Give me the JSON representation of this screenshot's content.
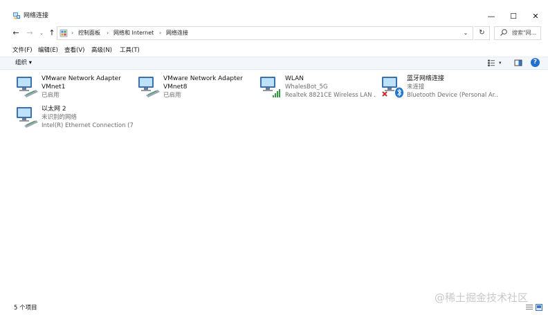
{
  "window": {
    "title": "网络连接",
    "minimize_glyph": "—",
    "maximize_glyph": "☐",
    "close_glyph": "✕"
  },
  "address": {
    "crumbs": [
      "控制面板",
      "网络和 Internet",
      "网络连接"
    ],
    "separator": "›",
    "search_placeholder": "搜索\"网..."
  },
  "nav": {
    "back": "←",
    "forward": "→",
    "recent": "⌄",
    "up": "↑",
    "dropdown": "⌄",
    "refresh": "↻"
  },
  "menu": [
    "文件(F)",
    "编辑(E)",
    "查看(V)",
    "高级(N)",
    "工具(T)"
  ],
  "toolbar": {
    "organize_label": "组织 ▾",
    "view_dropdown": "▾",
    "help_label": "?"
  },
  "connections": [
    {
      "name": "VMware Network Adapter VMnet1",
      "line1": "VMware Network Adapter",
      "line2": "VMnet1",
      "status": "已启用",
      "device": "",
      "icon": "ethernet-adapter-icon"
    },
    {
      "name": "VMware Network Adapter VMnet8",
      "line1": "VMware Network Adapter",
      "line2": "VMnet8",
      "status": "已启用",
      "device": "",
      "icon": "ethernet-adapter-icon"
    },
    {
      "name": "WLAN",
      "line1": "WLAN",
      "line2": "",
      "status": "WhalesBot_5G",
      "device": "Realtek 8821CE Wireless LAN ...",
      "icon": "wlan-adapter-icon"
    },
    {
      "name": "蓝牙网络连接",
      "line1": "蓝牙网络连接",
      "line2": "",
      "status": "未连接",
      "device": "Bluetooth Device (Personal Ar...",
      "icon": "bluetooth-adapter-icon"
    },
    {
      "name": "以太网 2",
      "line1": "以太网 2",
      "line2": "",
      "status": "未识别的网络",
      "device": "Intel(R) Ethernet Connection (7...",
      "icon": "ethernet-adapter-icon"
    }
  ],
  "statusbar": {
    "count_text": "5 个项目"
  },
  "watermark": "@稀土掘金技术社区",
  "colors": {
    "accent": "#1f6fd6",
    "commandbar_bg": "#f3f6fb",
    "secondary_text": "#6d6d6d",
    "wifi_green": "#2e9e3a",
    "error_red": "#d4262b"
  }
}
